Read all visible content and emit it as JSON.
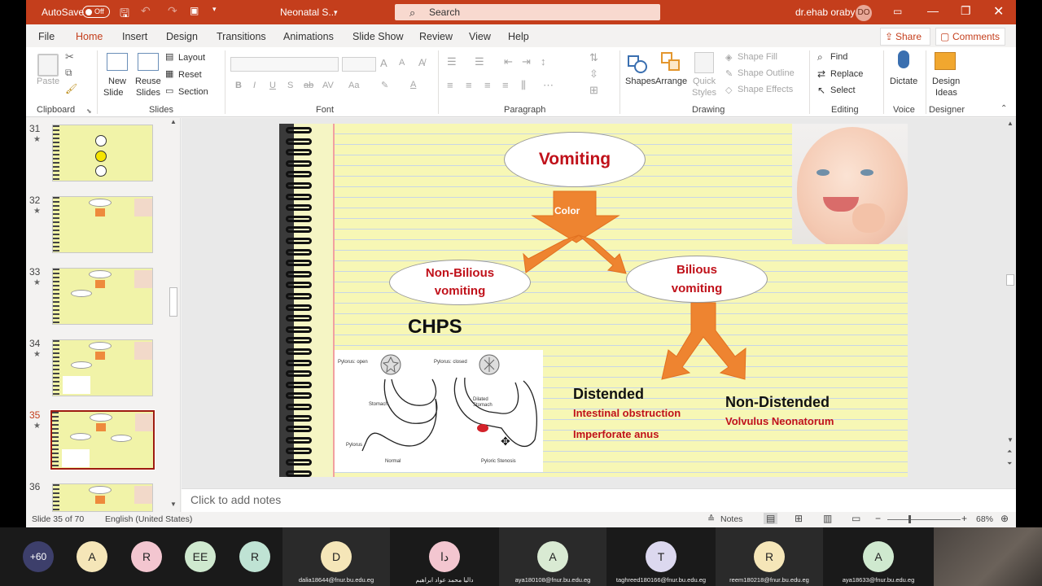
{
  "titlebar": {
    "autosave_label": "AutoSave",
    "autosave_state": "Off",
    "filename": "Neonatal S...",
    "search_placeholder": "Search",
    "user_name": "dr.ehab oraby",
    "user_initials": "DO",
    "accent": "#c43e1c"
  },
  "tabs": [
    "File",
    "Home",
    "Insert",
    "Design",
    "Transitions",
    "Animations",
    "Slide Show",
    "Review",
    "View",
    "Help"
  ],
  "active_tab": "Home",
  "share_label": "Share",
  "comments_label": "Comments",
  "ribbon": {
    "clipboard": {
      "paste": "Paste",
      "group": "Clipboard"
    },
    "slides": {
      "new_slide": "New Slide",
      "new_slide_l1": "New",
      "new_slide_l2": "Slide",
      "reuse_l1": "Reuse",
      "reuse_l2": "Slides",
      "layout": "Layout",
      "reset": "Reset",
      "section": "Section",
      "group": "Slides"
    },
    "font": {
      "group": "Font"
    },
    "paragraph": {
      "group": "Paragraph"
    },
    "drawing": {
      "shapes": "Shapes",
      "arrange": "Arrange",
      "quick_l1": "Quick",
      "quick_l2": "Styles",
      "shape_fill": "Shape Fill",
      "shape_outline": "Shape Outline",
      "shape_effects": "Shape Effects",
      "group": "Drawing"
    },
    "editing": {
      "find": "Find",
      "replace": "Replace",
      "select": "Select",
      "group": "Editing"
    },
    "voice": {
      "dictate": "Dictate",
      "group": "Voice"
    },
    "designer": {
      "ideas_l1": "Design",
      "ideas_l2": "Ideas",
      "group": "Designer"
    }
  },
  "thumbnails": [
    {
      "num": "31"
    },
    {
      "num": "32"
    },
    {
      "num": "33"
    },
    {
      "num": "34"
    },
    {
      "num": "35",
      "selected": true
    },
    {
      "num": "36"
    }
  ],
  "slide": {
    "top": "Vomiting",
    "arrow_label": "Color",
    "left_l1": "Non-Bilious",
    "left_l2": "vomiting",
    "right_l1": "Bilious",
    "right_l2": "vomiting",
    "chps": "CHPS",
    "distended": "Distended",
    "distended_items": [
      "Intestinal obstruction",
      "Imperforate anus"
    ],
    "nondistended": "Non-Distended",
    "nondistended_item": "Volvulus Neonatorum",
    "fig_open": "Pylorus: open",
    "fig_closed": "Pylorus: closed",
    "fig_stomach": "Stomach",
    "fig_dilated_l1": "Dilated",
    "fig_dilated_l2": "Stomach",
    "fig_pylorus": "Pylorus",
    "fig_normal": "Normal",
    "fig_stenosis": "Pyloric Stenosis"
  },
  "notes_placeholder": "Click to add notes",
  "status": {
    "slide_counter": "Slide 35 of 70",
    "language": "English (United States)",
    "notes": "Notes",
    "zoom": "68%"
  },
  "meeting": {
    "more": "+60",
    "participants": [
      {
        "initial": "A",
        "color": "#f5e6b8"
      },
      {
        "initial": "R",
        "color": "#f3c6d0"
      },
      {
        "initial": "EE",
        "color": "#cfe9cf"
      },
      {
        "initial": "R",
        "color": "#bfe3d4"
      },
      {
        "initial": "D",
        "color": "#f5e6b8",
        "email": "dalia18644@fnur.bu.edu.eg"
      },
      {
        "initial": "دا",
        "color": "#f3c6d0",
        "email": "داليا محمد عواد ابراهيم"
      },
      {
        "initial": "A",
        "color": "#d9ead3",
        "email": "aya180108@fnur.bu.edu.eg"
      },
      {
        "initial": "T",
        "color": "#dcd8ef",
        "email": "taghreed180166@fnur.bu.edu.eg"
      },
      {
        "initial": "R",
        "color": "#f5e6b8",
        "email": "reem180218@fnur.bu.edu.eg"
      },
      {
        "initial": "A",
        "color": "#cfe9cf",
        "email": "aya18633@fnur.bu.edu.eg"
      }
    ]
  }
}
